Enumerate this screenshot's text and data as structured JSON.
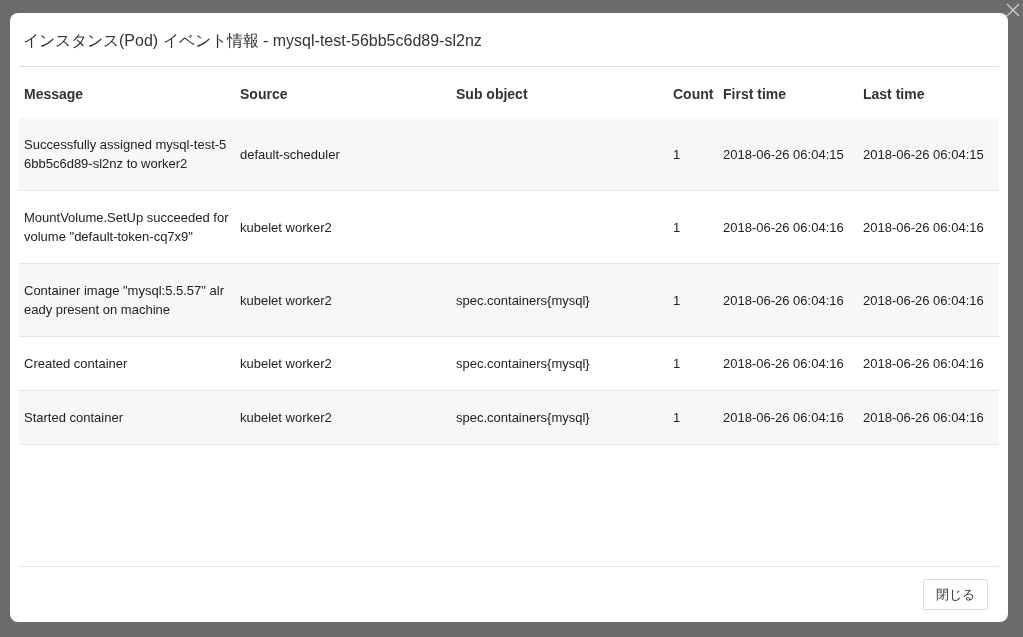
{
  "dialog": {
    "title": "インスタンス(Pod) イベント情報 - mysql-test-56bb5c6d89-sl2nz",
    "table": {
      "columns": [
        "Message",
        "Source",
        "Sub object",
        "Count",
        "First time",
        "Last time"
      ],
      "rows": [
        {
          "cells": [
            "Successfully assigned mysql-test-56bb5c6d89-sl2nz to worker2",
            "default-scheduler",
            "",
            "1",
            "2018-06-26 06:04:15",
            "2018-06-26 06:04:15"
          ]
        },
        {
          "cells": [
            "MountVolume.SetUp succeeded for volume \"default-token-cq7x9\"",
            "kubelet worker2",
            "",
            "1",
            "2018-06-26 06:04:16",
            "2018-06-26 06:04:16"
          ]
        },
        {
          "cells": [
            "Container image \"mysql:5.5.57\" already present on machine",
            "kubelet worker2",
            "spec.containers{mysql}",
            "1",
            "2018-06-26 06:04:16",
            "2018-06-26 06:04:16"
          ]
        },
        {
          "cells": [
            "Created container",
            "kubelet worker2",
            "spec.containers{mysql}",
            "1",
            "2018-06-26 06:04:16",
            "2018-06-26 06:04:16"
          ]
        },
        {
          "cells": [
            "Started container",
            "kubelet worker2",
            "spec.containers{mysql}",
            "1",
            "2018-06-26 06:04:16",
            "2018-06-26 06:04:16"
          ]
        }
      ]
    },
    "buttons": [
      "閉じる"
    ]
  }
}
